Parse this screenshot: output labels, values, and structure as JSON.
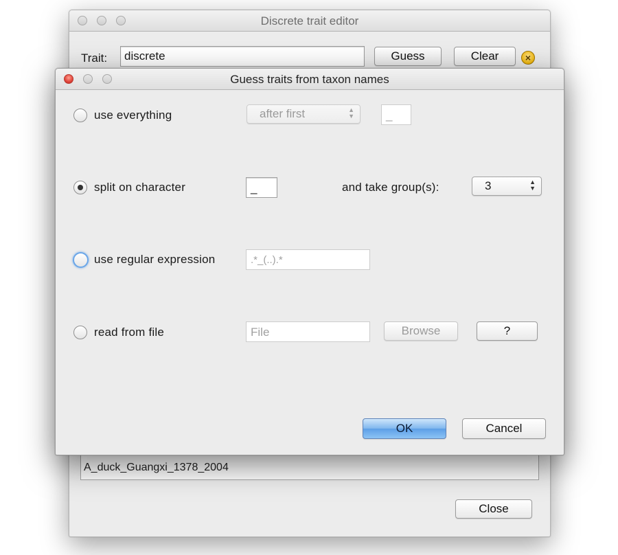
{
  "back_window": {
    "title": "Discrete trait editor",
    "trait_label": "Trait:",
    "trait_value": "discrete",
    "guess_button": "Guess",
    "clear_button": "Clear",
    "clear_icon": "close-circle-icon",
    "list_rows": [
      "A_duck_Guangxi_1378_2004"
    ],
    "close_button": "Close"
  },
  "dialog": {
    "title": "Guess traits from taxon names",
    "options": {
      "use_everything": {
        "label": "use everything",
        "selected": false,
        "mode_select": "after first",
        "separator_value": "_"
      },
      "split_on_character": {
        "label": "split on character",
        "selected": true,
        "character_value": "_",
        "groups_label": "and take group(s):",
        "groups_value": "3"
      },
      "regular_expression": {
        "label": "use regular expression",
        "selected": false,
        "regex_value": ".*_(..).*"
      },
      "read_from_file": {
        "label": "read from file",
        "selected": false,
        "file_placeholder": "File",
        "browse_button": "Browse",
        "help_button": "?"
      }
    },
    "ok_button": "OK",
    "cancel_button": "Cancel"
  },
  "colors": {
    "window_bg": "#ececec",
    "default_button": "#6aaaf0",
    "focus_ring": "#6aa6e8"
  }
}
